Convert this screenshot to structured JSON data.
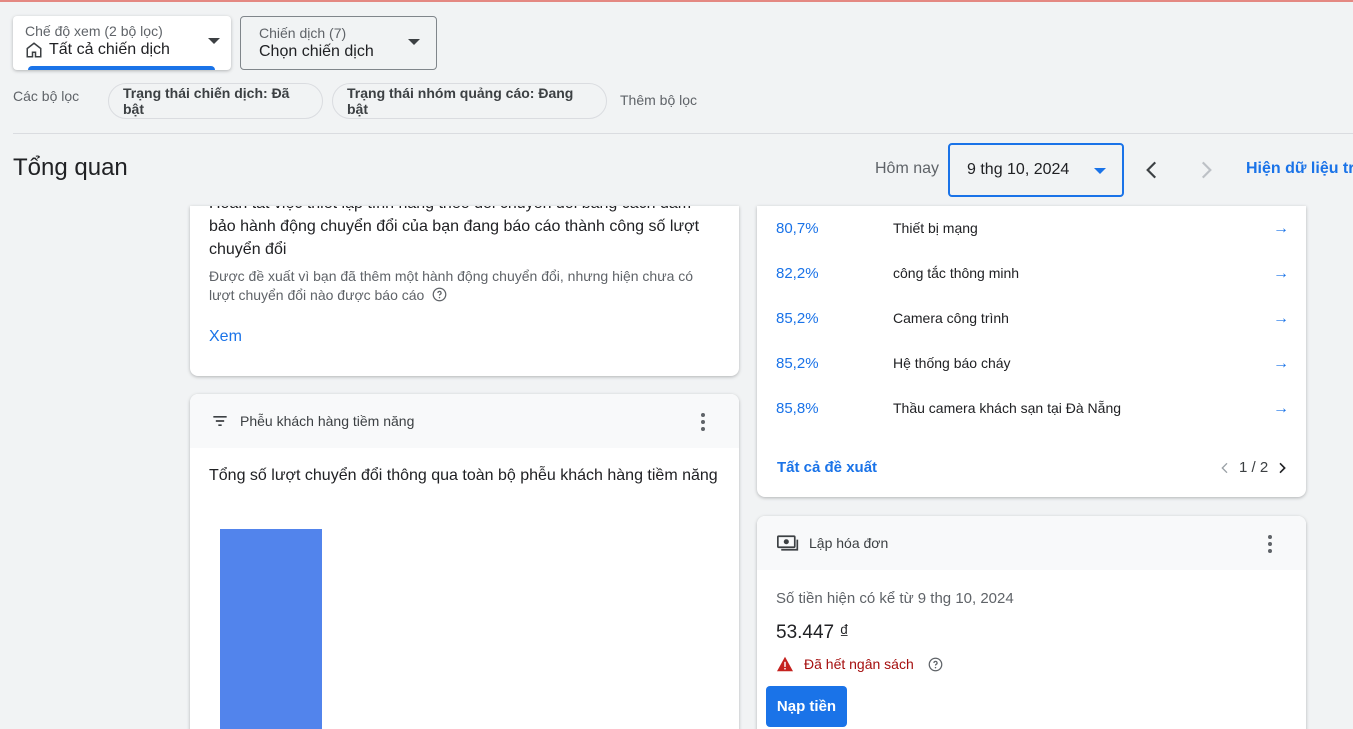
{
  "view_selector": {
    "caption": "Chế độ xem (2 bộ lọc)",
    "value": "Tất cả chiến dịch"
  },
  "campaign_selector": {
    "caption": "Chiến dịch (7)",
    "value": "Chọn chiến dịch"
  },
  "filters": {
    "label": "Các bộ lọc",
    "chips": [
      "Trạng thái chiến dịch: Đã bật",
      "Trạng thái nhóm quảng cáo: Đang bật"
    ],
    "add_label": "Thêm bộ lọc"
  },
  "overview": {
    "title": "Tổng quan",
    "today_label": "Hôm nay",
    "date": "9 thg 10, 2024",
    "show_data_label": "Hiện dữ liệu trc"
  },
  "conversion_card": {
    "title": "Hoàn tất việc thiết lập tính năng theo dõi chuyển đổi bằng cách đảm bảo hành động chuyển đổi của bạn đang báo cáo thành công số lượt chuyển đổi",
    "description": "Được đề xuất vì bạn đã thêm một hành động chuyển đổi, nhưng hiện chưa có lượt chuyển đổi nào được báo cáo",
    "link": "Xem"
  },
  "funnel_card": {
    "header": "Phễu khách hàng tiềm năng",
    "title": "Tổng số lượt chuyển đổi thông qua toàn bộ phễu khách hàng tiềm năng"
  },
  "recommendations": {
    "rows": [
      {
        "pct": "80,7%",
        "name": "Thiết bị mạng"
      },
      {
        "pct": "82,2%",
        "name": "công tắc thông minh"
      },
      {
        "pct": "85,2%",
        "name": "Camera công trình"
      },
      {
        "pct": "85,2%",
        "name": "Hệ thống báo cháy"
      },
      {
        "pct": "85,8%",
        "name": "Thầu camera khách sạn tại Đà Nẵng"
      }
    ],
    "all_label": "Tất cả đề xuất",
    "pager": "1 / 2"
  },
  "billing": {
    "header": "Lập hóa đơn",
    "balance_label": "Số tiền hiện có kể từ 9 thg 10, 2024",
    "amount": "53.447 ₫",
    "status": "Đã hết ngân sách",
    "topup_label": "Nạp tiền"
  },
  "colors": {
    "accent": "#1a73e8",
    "warning": "#a50e0e",
    "funnel_bar": "#5284ec"
  }
}
